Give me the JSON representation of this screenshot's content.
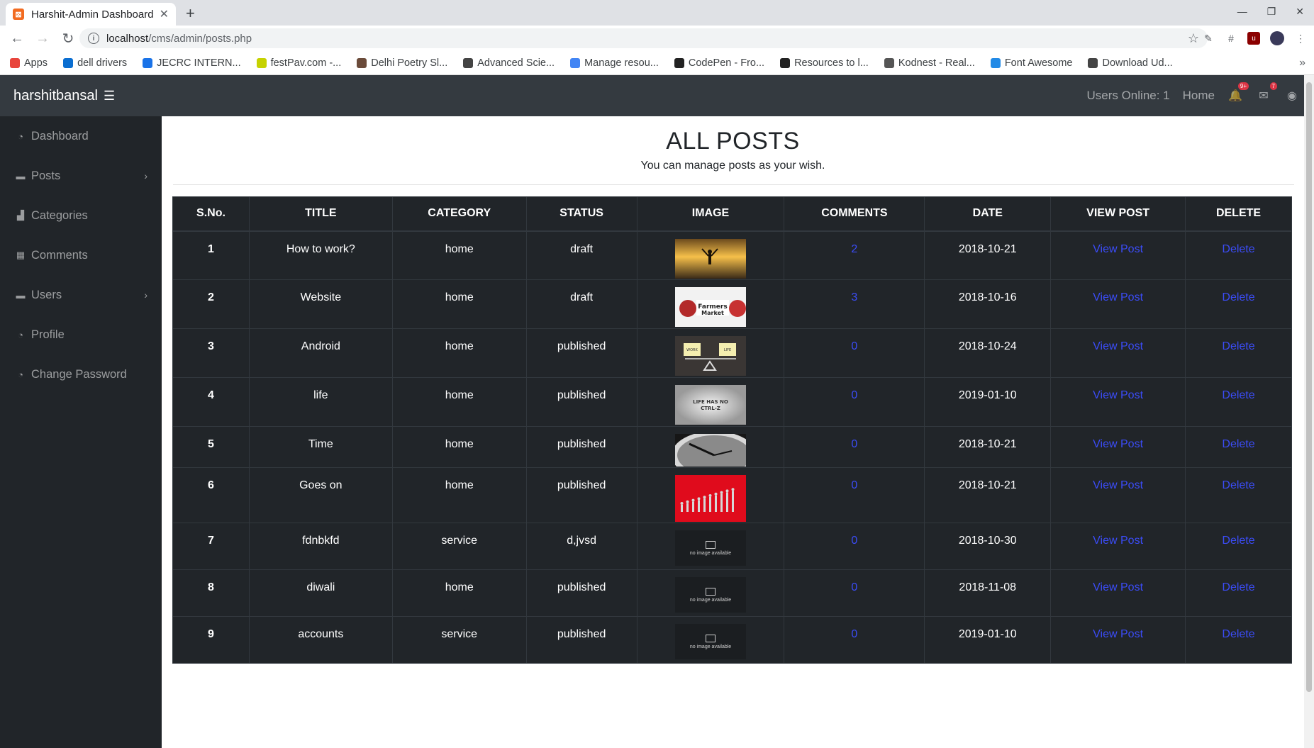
{
  "browser": {
    "tab_title": "Harshit-Admin Dashboard",
    "url_host": "localhost",
    "url_path": "/cms/admin/posts.php",
    "bookmarks": [
      {
        "label": "Apps",
        "color": "#e8453c"
      },
      {
        "label": "dell drivers",
        "color": "#0a6ed1"
      },
      {
        "label": "JECRC INTERN...",
        "color": "#1a73e8"
      },
      {
        "label": "festPav.com -...",
        "color": "#c6d200"
      },
      {
        "label": "Delhi Poetry Sl...",
        "color": "#6b4b3a"
      },
      {
        "label": "Advanced Scie...",
        "color": "#444444"
      },
      {
        "label": "Manage resou...",
        "color": "#4285f4"
      },
      {
        "label": "CodePen - Fro...",
        "color": "#222222"
      },
      {
        "label": "Resources to l...",
        "color": "#222222"
      },
      {
        "label": "Kodnest - Real...",
        "color": "#555555"
      },
      {
        "label": "Font Awesome",
        "color": "#228ae6"
      },
      {
        "label": "Download Ud...",
        "color": "#444444"
      }
    ]
  },
  "topbar": {
    "brand": "harshitbansal",
    "users_online": "Users Online: 1",
    "home": "Home",
    "notif_badge": "9+",
    "msg_badge": "7"
  },
  "sidebar": {
    "items": [
      {
        "label": "Dashboard"
      },
      {
        "label": "Posts"
      },
      {
        "label": "Categories"
      },
      {
        "label": "Comments"
      },
      {
        "label": "Users"
      },
      {
        "label": "Profile"
      },
      {
        "label": "Change Password"
      }
    ]
  },
  "page": {
    "title": "ALL POSTS",
    "subtitle": "You can manage posts as your wish."
  },
  "table": {
    "headers": [
      "S.No.",
      "TITLE",
      "CATEGORY",
      "STATUS",
      "IMAGE",
      "COMMENTS",
      "DATE",
      "VIEW POST",
      "DELETE"
    ],
    "view_label": "View Post",
    "delete_label": "Delete",
    "no_image_text": "no image available",
    "rows": [
      {
        "sno": "1",
        "title": "How to work?",
        "category": "home",
        "status": "draft",
        "image": "sunset",
        "comments": "2",
        "date": "2018-10-21"
      },
      {
        "sno": "2",
        "title": "Website",
        "category": "home",
        "status": "draft",
        "image": "farmers",
        "comments": "3",
        "date": "2018-10-16"
      },
      {
        "sno": "3",
        "title": "Android",
        "category": "home",
        "status": "published",
        "image": "worklife",
        "comments": "0",
        "date": "2018-10-24"
      },
      {
        "sno": "4",
        "title": "life",
        "category": "home",
        "status": "published",
        "image": "ctrlz",
        "comments": "0",
        "date": "2019-01-10"
      },
      {
        "sno": "5",
        "title": "Time",
        "category": "home",
        "status": "published",
        "image": "clock",
        "comments": "0",
        "date": "2018-10-21"
      },
      {
        "sno": "6",
        "title": "Goes on",
        "category": "home",
        "status": "published",
        "image": "red",
        "comments": "0",
        "date": "2018-10-21"
      },
      {
        "sno": "7",
        "title": "fdnbkfd",
        "category": "service",
        "status": "d,jvsd",
        "image": "none",
        "comments": "0",
        "date": "2018-10-30"
      },
      {
        "sno": "8",
        "title": "diwali",
        "category": "home",
        "status": "published",
        "image": "none",
        "comments": "0",
        "date": "2018-11-08"
      },
      {
        "sno": "9",
        "title": "accounts",
        "category": "service",
        "status": "published",
        "image": "none",
        "comments": "0",
        "date": "2019-01-10"
      }
    ]
  }
}
